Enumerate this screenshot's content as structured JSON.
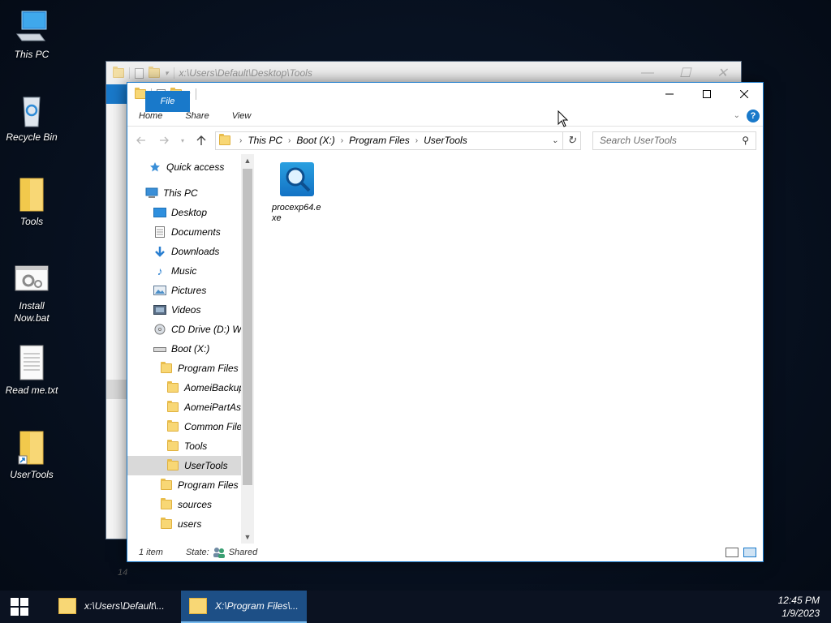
{
  "desktop": {
    "icons": [
      {
        "label": "This PC",
        "icon": "computer-icon"
      },
      {
        "label": "Recycle Bin",
        "icon": "recycle-bin-icon"
      },
      {
        "label": "Tools",
        "icon": "folder-icon"
      },
      {
        "label": "Install Now.bat",
        "icon": "batch-file-icon"
      },
      {
        "label": "Read me.txt",
        "icon": "text-file-icon"
      },
      {
        "label": "UserTools",
        "icon": "folder-shortcut-icon"
      }
    ]
  },
  "back_window": {
    "title": "x:\\Users\\Default\\Desktop\\Tools",
    "status_fragment": "14"
  },
  "window": {
    "ribbon_tabs": [
      "File",
      "Home",
      "Share",
      "View"
    ],
    "breadcrumb": [
      "This PC",
      "Boot (X:)",
      "Program Files",
      "UserTools"
    ],
    "search_placeholder": "Search UserTools",
    "nav": [
      {
        "label": "Quick access",
        "icon": "star-icon"
      },
      {
        "label": "This PC",
        "icon": "computer-icon"
      },
      {
        "label": "Desktop",
        "icon": "desktop-icon"
      },
      {
        "label": "Documents",
        "icon": "documents-icon"
      },
      {
        "label": "Downloads",
        "icon": "download-icon"
      },
      {
        "label": "Music",
        "icon": "music-icon"
      },
      {
        "label": "Pictures",
        "icon": "pictures-icon"
      },
      {
        "label": "Videos",
        "icon": "videos-icon"
      },
      {
        "label": "CD Drive (D:) W",
        "icon": "cd-drive-icon"
      },
      {
        "label": "Boot (X:)",
        "icon": "drive-icon"
      },
      {
        "label": "Program Files",
        "icon": "folder-icon"
      },
      {
        "label": "AomeiBackup",
        "icon": "folder-icon"
      },
      {
        "label": "AomeiPartAss",
        "icon": "folder-icon"
      },
      {
        "label": "Common Files",
        "icon": "folder-icon"
      },
      {
        "label": "Tools",
        "icon": "folder-icon"
      },
      {
        "label": "UserTools",
        "icon": "folder-icon",
        "selected": true
      },
      {
        "label": "Program Files (",
        "icon": "folder-icon"
      },
      {
        "label": "sources",
        "icon": "folder-icon"
      },
      {
        "label": "users",
        "icon": "folder-icon"
      }
    ],
    "files": [
      {
        "name": "procexp64.exe",
        "icon": "process-explorer-icon"
      }
    ],
    "status": {
      "item_count": "1 item",
      "state_label": "State:",
      "state_value": "Shared"
    }
  },
  "taskbar": {
    "items": [
      {
        "label": "x:\\Users\\Default\\...",
        "active": false
      },
      {
        "label": "X:\\Program Files\\...",
        "active": true
      }
    ],
    "time": "12:45 PM",
    "date": "1/9/2023"
  }
}
